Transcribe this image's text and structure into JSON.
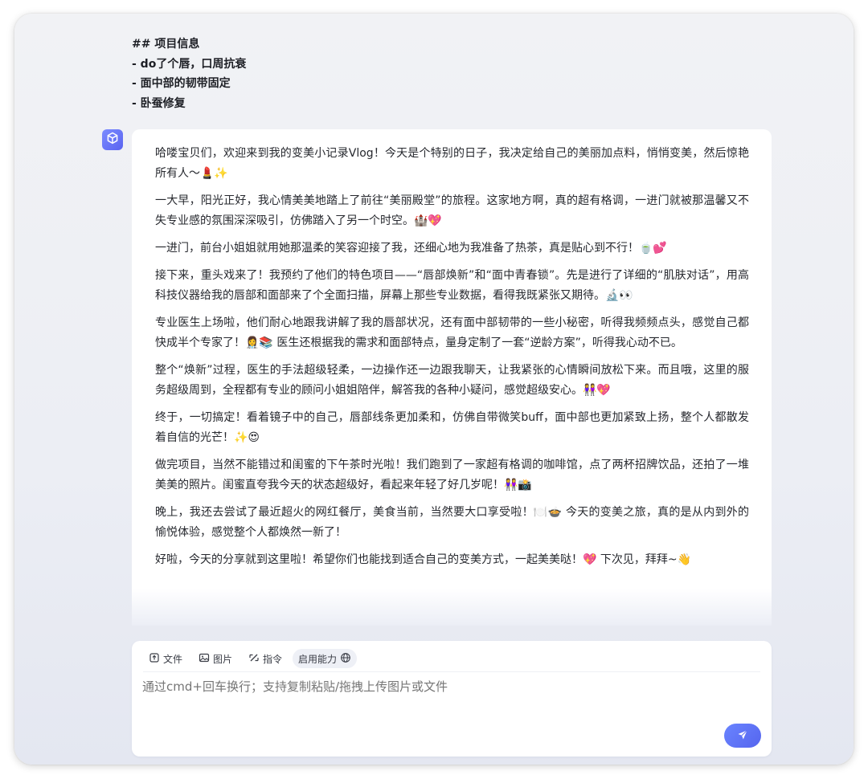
{
  "user_message": {
    "lines": [
      "## 项目信息",
      "- do了个唇，口周抗衰",
      "- 面中部的韧带固定",
      "- 卧蚕修复"
    ]
  },
  "bot": {
    "avatar_icon": "cube-logo-icon",
    "paragraphs": [
      "哈喽宝贝们，欢迎来到我的变美小记录Vlog！今天是个特别的日子，我决定给自己的美丽加点料，悄悄变美，然后惊艳所有人～💄✨",
      "一大早，阳光正好，我心情美美地踏上了前往“美丽殿堂”的旅程。这家地方啊，真的超有格调，一进门就被那温馨又不失专业感的氛围深深吸引，仿佛踏入了另一个时空。🏰💖",
      "一进门，前台小姐姐就用她那温柔的笑容迎接了我，还细心地为我准备了热茶，真是贴心到不行！🍵💕",
      "接下来，重头戏来了！我预约了他们的特色项目——“唇部焕新”和“面中青春锁”。先是进行了详细的“肌肤对话”，用高科技仪器给我的唇部和面部来了个全面扫描，屏幕上那些专业数据，看得我既紧张又期待。🔬👀",
      "专业医生上场啦，他们耐心地跟我讲解了我的唇部状况，还有面中部韧带的一些小秘密，听得我频频点头，感觉自己都快成半个专家了！👩‍⚕️📚 医生还根据我的需求和面部特点，量身定制了一套“逆龄方案”，听得我心动不已。",
      "整个“焕新”过程，医生的手法超级轻柔，一边操作还一边跟我聊天，让我紧张的心情瞬间放松下来。而且哦，这里的服务超级周到，全程都有专业的顾问小姐姐陪伴，解答我的各种小疑问，感觉超级安心。👭💖",
      "终于，一切搞定！看着镜子中的自己，唇部线条更加柔和，仿佛自带微笑buff，面中部也更加紧致上扬，整个人都散发着自信的光芒！✨😍",
      "做完项目，当然不能错过和闺蜜的下午茶时光啦！我们跑到了一家超有格调的咖啡馆，点了两杯招牌饮品，还拍了一堆美美的照片。闺蜜直夸我今天的状态超级好，看起来年轻了好几岁呢！👭📸",
      "晚上，我还去尝试了最近超火的网红餐厅，美食当前，当然要大口享受啦！🍽️🍲 今天的变美之旅，真的是从内到外的愉悦体验，感觉整个人都焕然一新了！",
      "好啦，今天的分享就到这里啦！希望你们也能找到适合自己的变美方式，一起美美哒！💖 下次见，拜拜~👋"
    ]
  },
  "composer": {
    "tools": [
      {
        "label": "文件",
        "icon": "file-icon"
      },
      {
        "label": "图片",
        "icon": "image-icon"
      },
      {
        "label": "指令",
        "icon": "command-icon"
      }
    ],
    "ability_label": "启用能力",
    "ability_icon": "globe-icon",
    "placeholder": "通过cmd+回车换行；支持复制粘贴/拖拽上传图片或文件",
    "send_icon": "send-icon"
  }
}
